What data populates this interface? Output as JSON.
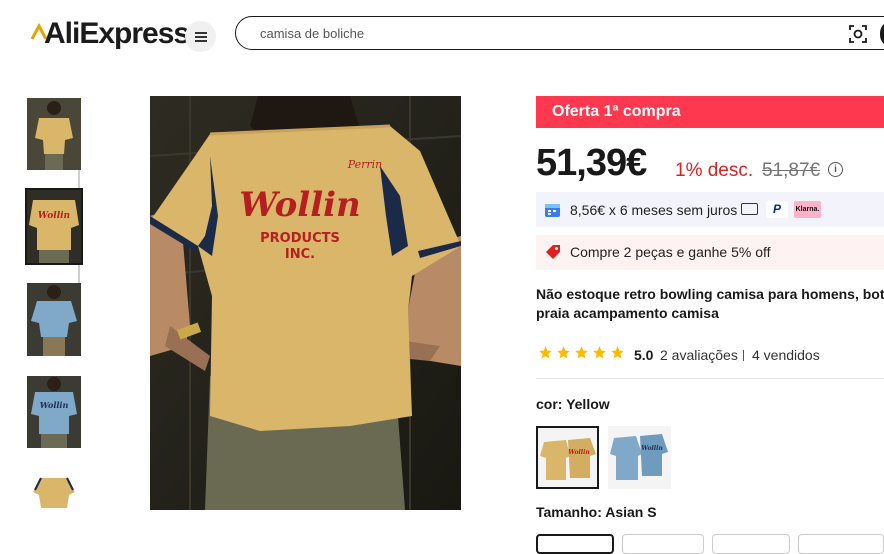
{
  "header": {
    "logo_text": "AliExpress",
    "search_value": "camisa de boliche"
  },
  "promo": {
    "label": "Oferta 1ª compra"
  },
  "price": {
    "current": "51,39€",
    "discount": "1% desc.",
    "original": "51,87€"
  },
  "installments": {
    "text": "8,56€ x 6 meses sem juros",
    "klarna": "Klarna."
  },
  "coupon": {
    "text": "Compre 2 peças e ganhe 5% off"
  },
  "product": {
    "title_line1": "Não estoque retro bowling camisa para homens, bot",
    "title_line2": "praia acampamento camisa"
  },
  "rating": {
    "stars": 5,
    "score": "5.0",
    "reviews": "2 avaliações",
    "sold": "4 vendidos"
  },
  "color": {
    "label": "cor: Yellow",
    "options": [
      "Yellow",
      "Blue"
    ],
    "selected": "Yellow"
  },
  "size": {
    "label": "Tamanho: Asian S"
  },
  "colors": {
    "brand_red": "#fd384f",
    "discount_red": "#e02020",
    "star": "#fcbb00",
    "shirt_yellow": "#d9b66a",
    "shirt_blue": "#7fa8c9"
  },
  "icons": [
    "menu-icon",
    "camera-search-icon",
    "installment-icon",
    "card-icon",
    "paypal-icon",
    "klarna-icon",
    "coupon-tag-icon",
    "star-icon",
    "info-icon"
  ]
}
